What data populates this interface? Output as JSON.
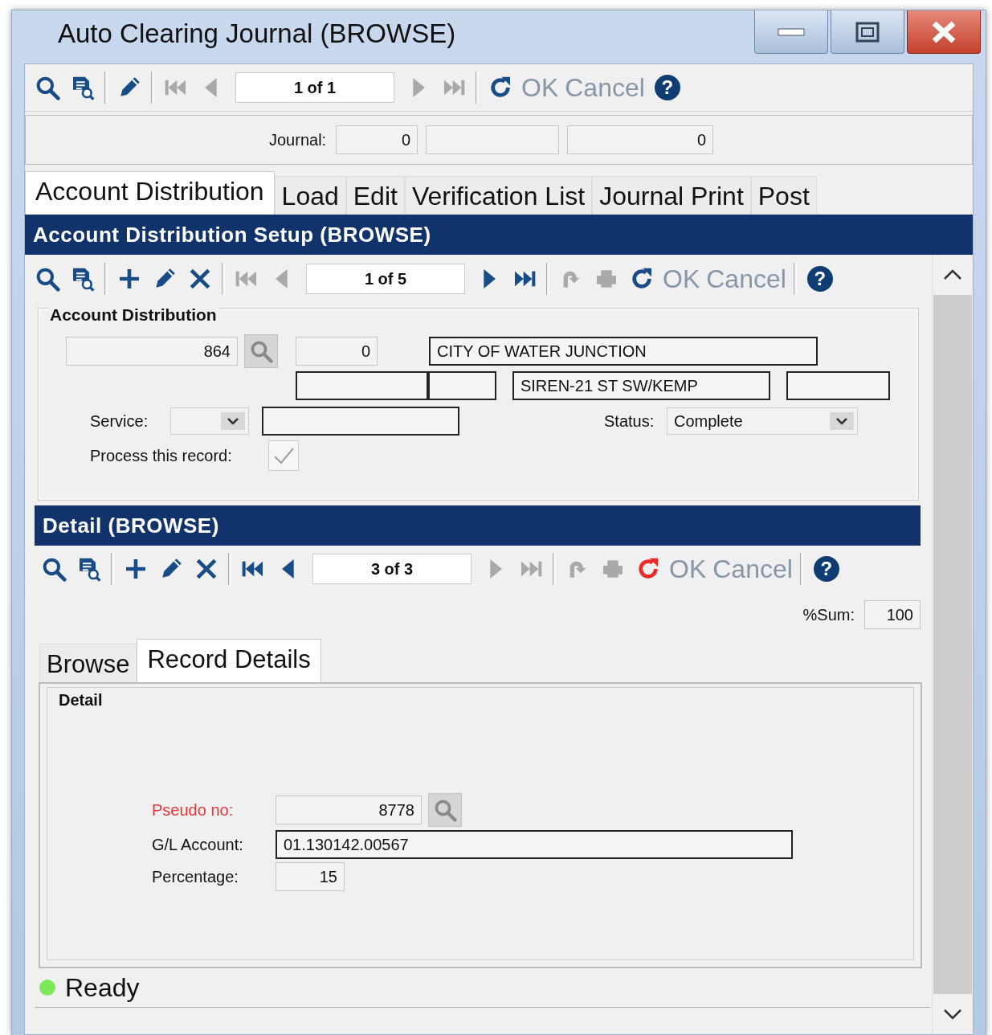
{
  "window": {
    "title": "Auto Clearing Journal (BROWSE)"
  },
  "main_toolbar": [
    {
      "kind": "search",
      "disabled": false
    },
    {
      "kind": "browse",
      "disabled": false
    },
    {
      "kind": "separator"
    },
    {
      "kind": "edit",
      "disabled": false
    },
    {
      "kind": "separator"
    },
    {
      "kind": "first",
      "disabled": true
    },
    {
      "kind": "prev",
      "disabled": true
    },
    {
      "kind": "counter",
      "text": "1 of 1"
    },
    {
      "kind": "next",
      "disabled": true
    },
    {
      "kind": "last",
      "disabled": true
    },
    {
      "kind": "separator"
    },
    {
      "kind": "refresh",
      "disabled": false,
      "highlighted": false
    },
    {
      "kind": "ok",
      "text": "OK",
      "disabled": true
    },
    {
      "kind": "cancel",
      "text": "Cancel",
      "disabled": true
    },
    {
      "kind": "help",
      "text": "?",
      "disabled": false
    }
  ],
  "journal": {
    "label": "Journal:",
    "fields": [
      {
        "value": "0",
        "readonly": true
      },
      {
        "readonly": true
      },
      {
        "value": "0",
        "readonly": true
      }
    ]
  },
  "tabs": [
    {
      "label": "Account Distribution",
      "selected": true
    },
    {
      "label": "Load",
      "selected": false
    },
    {
      "label": "Edit",
      "selected": false
    },
    {
      "label": "Verification List",
      "selected": false
    },
    {
      "label": "Journal Print",
      "selected": false
    },
    {
      "label": "Post",
      "selected": false
    }
  ],
  "setup": {
    "title": "Account Distribution Setup (BROWSE)",
    "toolbar": [
      {
        "kind": "search",
        "disabled": false
      },
      {
        "kind": "browse",
        "disabled": false
      },
      {
        "kind": "separator"
      },
      {
        "kind": "add",
        "disabled": false
      },
      {
        "kind": "edit",
        "disabled": false
      },
      {
        "kind": "delete",
        "disabled": false
      },
      {
        "kind": "separator"
      },
      {
        "kind": "first",
        "disabled": true
      },
      {
        "kind": "prev",
        "disabled": true
      },
      {
        "kind": "counter",
        "text": "1 of 5"
      },
      {
        "kind": "next",
        "disabled": false
      },
      {
        "kind": "last",
        "disabled": false
      },
      {
        "kind": "separator"
      },
      {
        "kind": "undo",
        "disabled": true
      },
      {
        "kind": "print",
        "disabled": true
      },
      {
        "kind": "refresh",
        "disabled": false,
        "highlighted": false
      },
      {
        "kind": "ok",
        "text": "OK",
        "disabled": true
      },
      {
        "kind": "cancel",
        "text": "Cancel",
        "disabled": true
      },
      {
        "kind": "separator"
      },
      {
        "kind": "help",
        "text": "?",
        "disabled": false
      }
    ],
    "group": {
      "title": "Account Distribution",
      "customer": {
        "value": "864",
        "readonly": true
      },
      "sub": {
        "value": "0",
        "readonly": true
      },
      "name": {
        "value": "CITY OF WATER JUNCTION",
        "readonly": false
      },
      "address": [
        {
          "readonly": false
        },
        {
          "readonly": false
        },
        {
          "value": "SIREN-21 ST SW/KEMP",
          "readonly": false
        },
        {
          "readonly": false
        }
      ],
      "service": {
        "label": "Service:",
        "description": {
          "readonly": false
        }
      },
      "status": {
        "label": "Status:",
        "value": "Complete"
      },
      "process": {
        "label": "Process this record:",
        "checked": true,
        "disabled": true
      }
    }
  },
  "detail": {
    "title": "Detail (BROWSE)",
    "toolbar": [
      {
        "kind": "search",
        "disabled": false
      },
      {
        "kind": "browse",
        "disabled": false
      },
      {
        "kind": "separator"
      },
      {
        "kind": "add",
        "disabled": false
      },
      {
        "kind": "edit",
        "disabled": false
      },
      {
        "kind": "delete",
        "disabled": false
      },
      {
        "kind": "separator"
      },
      {
        "kind": "first",
        "disabled": false
      },
      {
        "kind": "prev",
        "disabled": false
      },
      {
        "kind": "counter",
        "text": "3 of 3"
      },
      {
        "kind": "next",
        "disabled": true
      },
      {
        "kind": "last",
        "disabled": true
      },
      {
        "kind": "separator"
      },
      {
        "kind": "undo",
        "disabled": true
      },
      {
        "kind": "print",
        "disabled": true
      },
      {
        "kind": "refresh",
        "disabled": false,
        "highlighted": true
      },
      {
        "kind": "ok",
        "text": "OK",
        "disabled": true
      },
      {
        "kind": "cancel",
        "text": "Cancel",
        "disabled": true
      },
      {
        "kind": "separator"
      },
      {
        "kind": "help",
        "text": "?",
        "disabled": false
      }
    ],
    "sum": {
      "label": "%Sum:",
      "value": "100"
    },
    "tabs": [
      {
        "label": "Browse",
        "selected": false
      },
      {
        "label": "Record Details",
        "selected": true
      }
    ],
    "group": {
      "title": "Detail",
      "fields": [
        {
          "label": "Pseudo no:",
          "value": "8778",
          "required": true,
          "readonly": true,
          "lookup": true
        },
        {
          "label": "G/L Account:",
          "value": "01.130142.00567",
          "required": false,
          "readonly": false,
          "lookup": false
        },
        {
          "label": "Percentage:",
          "value": "15",
          "required": false,
          "readonly": true,
          "lookup": false
        }
      ]
    }
  },
  "status_bar": {
    "text": "Ready",
    "color": "#7ee85a"
  }
}
